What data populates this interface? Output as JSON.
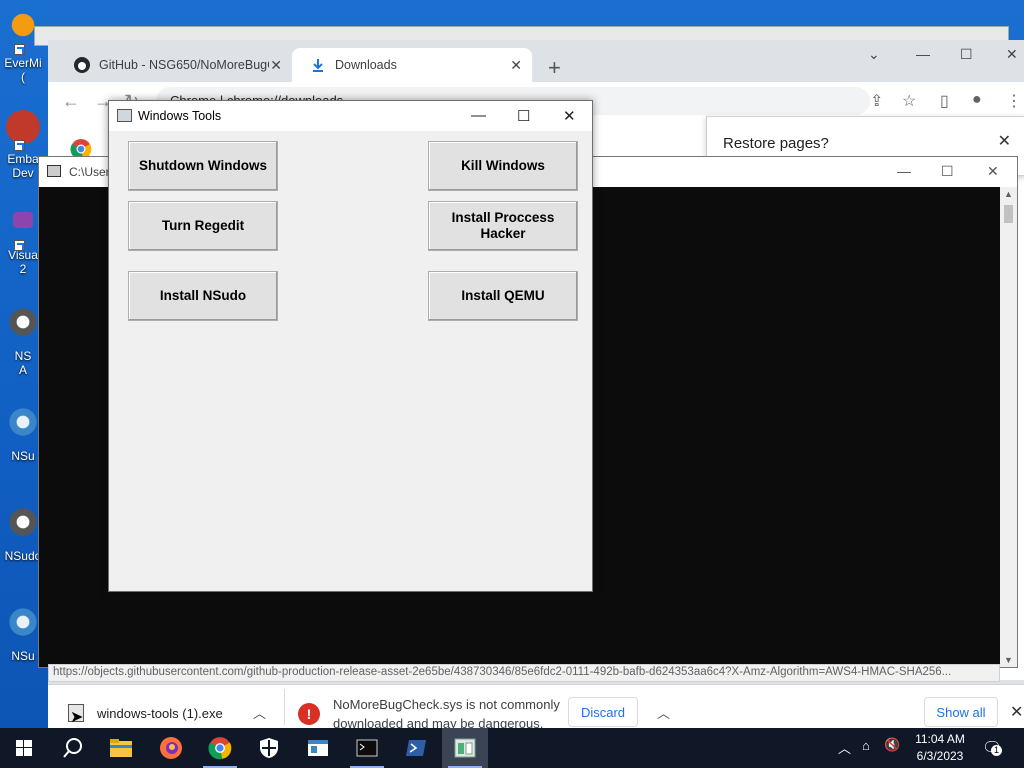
{
  "desktop": {
    "icons": [
      {
        "label": "EverMi\n(",
        "color": "#f39c12"
      },
      {
        "label": "Emba\nDev",
        "color": "#c0392b"
      },
      {
        "label": "Visua\n2",
        "color": "#8e44ad"
      },
      {
        "label": "NS\nA",
        "color": "#6b6b6b"
      },
      {
        "label": "NSu",
        "color": "#3a86c8"
      },
      {
        "label": "NSudo",
        "color": "#6b6b6b"
      },
      {
        "label": "NSu",
        "color": "#3a86c8"
      }
    ]
  },
  "chrome": {
    "tabs": [
      {
        "label": "GitHub - NSG650/NoMoreBugCh",
        "icon": "github-icon"
      },
      {
        "label": "Downloads",
        "icon": "download-icon"
      }
    ],
    "omnibox_text": "Chrome | chrome://downloads",
    "restore_prompt": "Restore pages?",
    "status_url": "https://objects.githubusercontent.com/github-production-release-asset-2e65be/438730346/85e6fdc2-0111-492b-bafb-d624353aa6c4?X-Amz-Algorithm=AWS4-HMAC-SHA256..."
  },
  "console": {
    "title": "C:\\User"
  },
  "tools_window": {
    "title": "Windows Tools",
    "buttons": {
      "shutdown": "Shutdown Windows",
      "kill": "Kill Windows",
      "regedit": "Turn Regedit",
      "process_hacker": "Install Proccess Hacker",
      "nsudo": "Install NSudo",
      "qemu": "Install QEMU"
    }
  },
  "downloads_shelf": {
    "file_name": "windows-tools (1).exe",
    "warning_text": "NoMoreBugCheck.sys is not commonly downloaded and may be dangerous.",
    "discard_label": "Discard",
    "show_all_label": "Show all"
  },
  "taskbar": {
    "time": "11:04 AM",
    "date": "6/3/2023",
    "notification_count": "1",
    "apps": [
      "search-icon",
      "file-explorer-icon",
      "firefox-icon",
      "chrome-icon",
      "defender-icon",
      "app-window-icon",
      "terminal-icon",
      "powershell-icon",
      "windows-tools-icon"
    ]
  },
  "colors": {
    "desktop": "#1160c4",
    "taskbar": "#101828",
    "chrome_accent": "#1a73e8",
    "warning_red": "#d93025"
  }
}
